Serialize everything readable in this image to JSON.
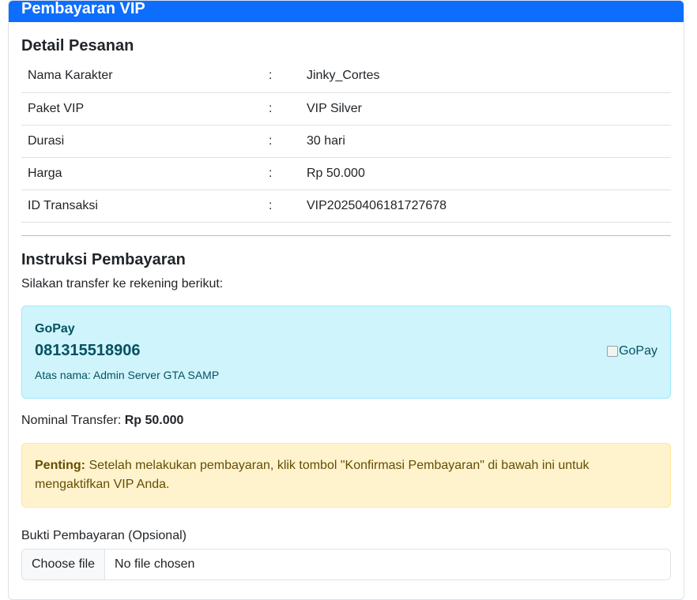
{
  "header": {
    "title": "Pembayaran VIP"
  },
  "order": {
    "heading": "Detail Pesanan",
    "separator": ":",
    "rows": [
      {
        "label": "Nama Karakter",
        "value": "Jinky_Cortes"
      },
      {
        "label": "Paket VIP",
        "value": "VIP Silver"
      },
      {
        "label": "Durasi",
        "value": "30 hari"
      },
      {
        "label": "Harga",
        "value": "Rp 50.000"
      },
      {
        "label": "ID Transaksi",
        "value": "VIP20250406181727678"
      }
    ]
  },
  "instructions": {
    "heading": "Instruksi Pembayaran",
    "text": "Silakan transfer ke rekening berikut:",
    "method": {
      "name": "GoPay",
      "number": "081315518906",
      "holder": "Atas nama: Admin Server GTA SAMP",
      "logo_alt": "GoPay"
    },
    "nominal_label": "Nominal Transfer:",
    "nominal_value": "Rp 50.000"
  },
  "notice": {
    "strong": "Penting:",
    "text": "Setelah melakukan pembayaran, klik tombol \"Konfirmasi Pembayaran\" di bawah ini untuk mengaktifkan VIP Anda."
  },
  "upload": {
    "label": "Bukti Pembayaran (Opsional)",
    "button": "Choose file",
    "status": "No file chosen"
  },
  "colors": {
    "header_bg": "#0d6efd",
    "info_bg": "#cff4fc",
    "warning_bg": "#fff3cd"
  }
}
